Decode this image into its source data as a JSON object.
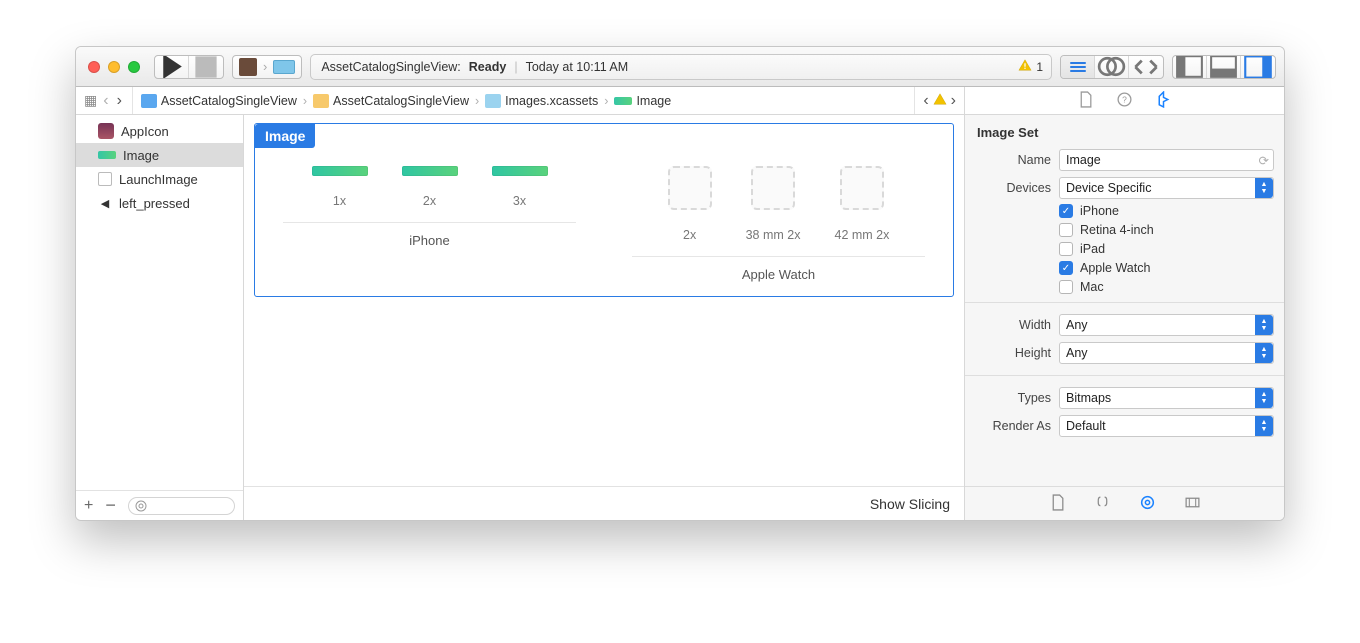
{
  "toolbar": {
    "status_project": "AssetCatalogSingleView:",
    "status_state": "Ready",
    "status_time": "Today at 10:11 AM",
    "warning_count": "1"
  },
  "breadcrumb": {
    "items": [
      {
        "label": "AssetCatalogSingleView"
      },
      {
        "label": "AssetCatalogSingleView"
      },
      {
        "label": "Images.xcassets"
      },
      {
        "label": "Image"
      }
    ]
  },
  "asset_list": {
    "items": [
      {
        "label": "AppIcon"
      },
      {
        "label": "Image"
      },
      {
        "label": "LaunchImage"
      },
      {
        "label": "left_pressed"
      }
    ]
  },
  "editor": {
    "set_title": "Image",
    "groups": [
      {
        "device": "iPhone",
        "slots": [
          {
            "label": "1x",
            "filled": true
          },
          {
            "label": "2x",
            "filled": true
          },
          {
            "label": "3x",
            "filled": true
          }
        ]
      },
      {
        "device": "Apple Watch",
        "slots": [
          {
            "label": "2x",
            "filled": false
          },
          {
            "label": "38 mm 2x",
            "filled": false
          },
          {
            "label": "42 mm 2x",
            "filled": false
          }
        ]
      }
    ],
    "footer_action": "Show Slicing"
  },
  "inspector": {
    "section_title": "Image Set",
    "fields": {
      "name_label": "Name",
      "name_value": "Image",
      "devices_label": "Devices",
      "devices_value": "Device Specific",
      "device_checks": [
        {
          "label": "iPhone",
          "checked": true
        },
        {
          "label": "Retina 4-inch",
          "checked": false
        },
        {
          "label": "iPad",
          "checked": false
        },
        {
          "label": "Apple Watch",
          "checked": true
        },
        {
          "label": "Mac",
          "checked": false
        }
      ],
      "width_label": "Width",
      "width_value": "Any",
      "height_label": "Height",
      "height_value": "Any",
      "types_label": "Types",
      "types_value": "Bitmaps",
      "render_label": "Render As",
      "render_value": "Default"
    }
  }
}
